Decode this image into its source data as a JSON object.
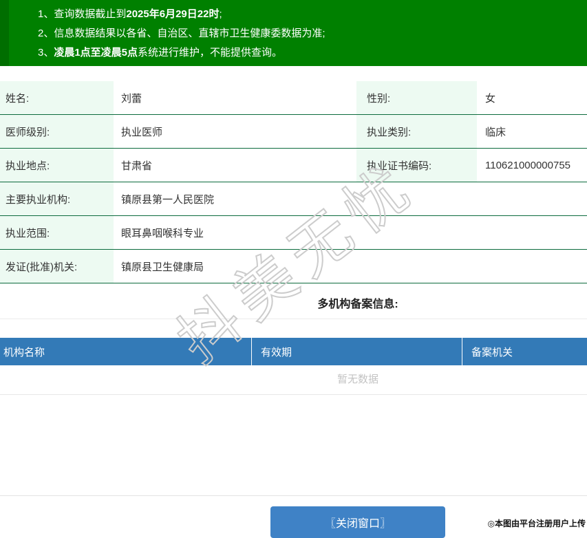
{
  "notice": {
    "items": [
      {
        "num": "1、",
        "pre": "查询数据截止到",
        "bold": "2025年6月29日22时",
        "post": ";"
      },
      {
        "num": "2、",
        "pre": "信息数据结果以各省、自治区、直辖市卫生健康委数据为准;",
        "bold": "",
        "post": ""
      },
      {
        "num": "3、",
        "pre": "",
        "bold": "凌晨1点至凌晨5点",
        "post": "系统进行维护，不能提供查询。"
      }
    ]
  },
  "info": {
    "rows": [
      {
        "label1": "姓名:",
        "value1": "刘蕾",
        "label2": "性别:",
        "value2": "女"
      },
      {
        "label1": "医师级别:",
        "value1": "执业医师",
        "label2": "执业类别:",
        "value2": "临床"
      },
      {
        "label1": "执业地点:",
        "value1": "甘肃省",
        "label2": "执业证书编码:",
        "value2": "110621000000755"
      },
      {
        "label1": "主要执业机构:",
        "value1": "镇原县第一人民医院"
      },
      {
        "label1": "执业范围:",
        "value1": "眼耳鼻咽喉科专业"
      },
      {
        "label1": "发证(批准)机关:",
        "value1": "镇原县卫生健康局"
      }
    ]
  },
  "multi_org": {
    "title": "多机构备案信息:",
    "columns": [
      "机构名称",
      "有效期",
      "备案机关"
    ],
    "empty_text": "暂无数据"
  },
  "footer": {
    "close_button": "〖关闭窗口〗"
  },
  "watermark": {
    "diagonal": "抖美无忧",
    "corner": "◎本图由平台注册用户上传"
  },
  "colors": {
    "notice_green": "#008000",
    "notice_stripe_green": "#006e00",
    "row_border_green": "#0b6a3c",
    "label_mint": "#edfaf2",
    "table_header_blue": "#337ab7",
    "button_blue": "#3f82c6"
  }
}
